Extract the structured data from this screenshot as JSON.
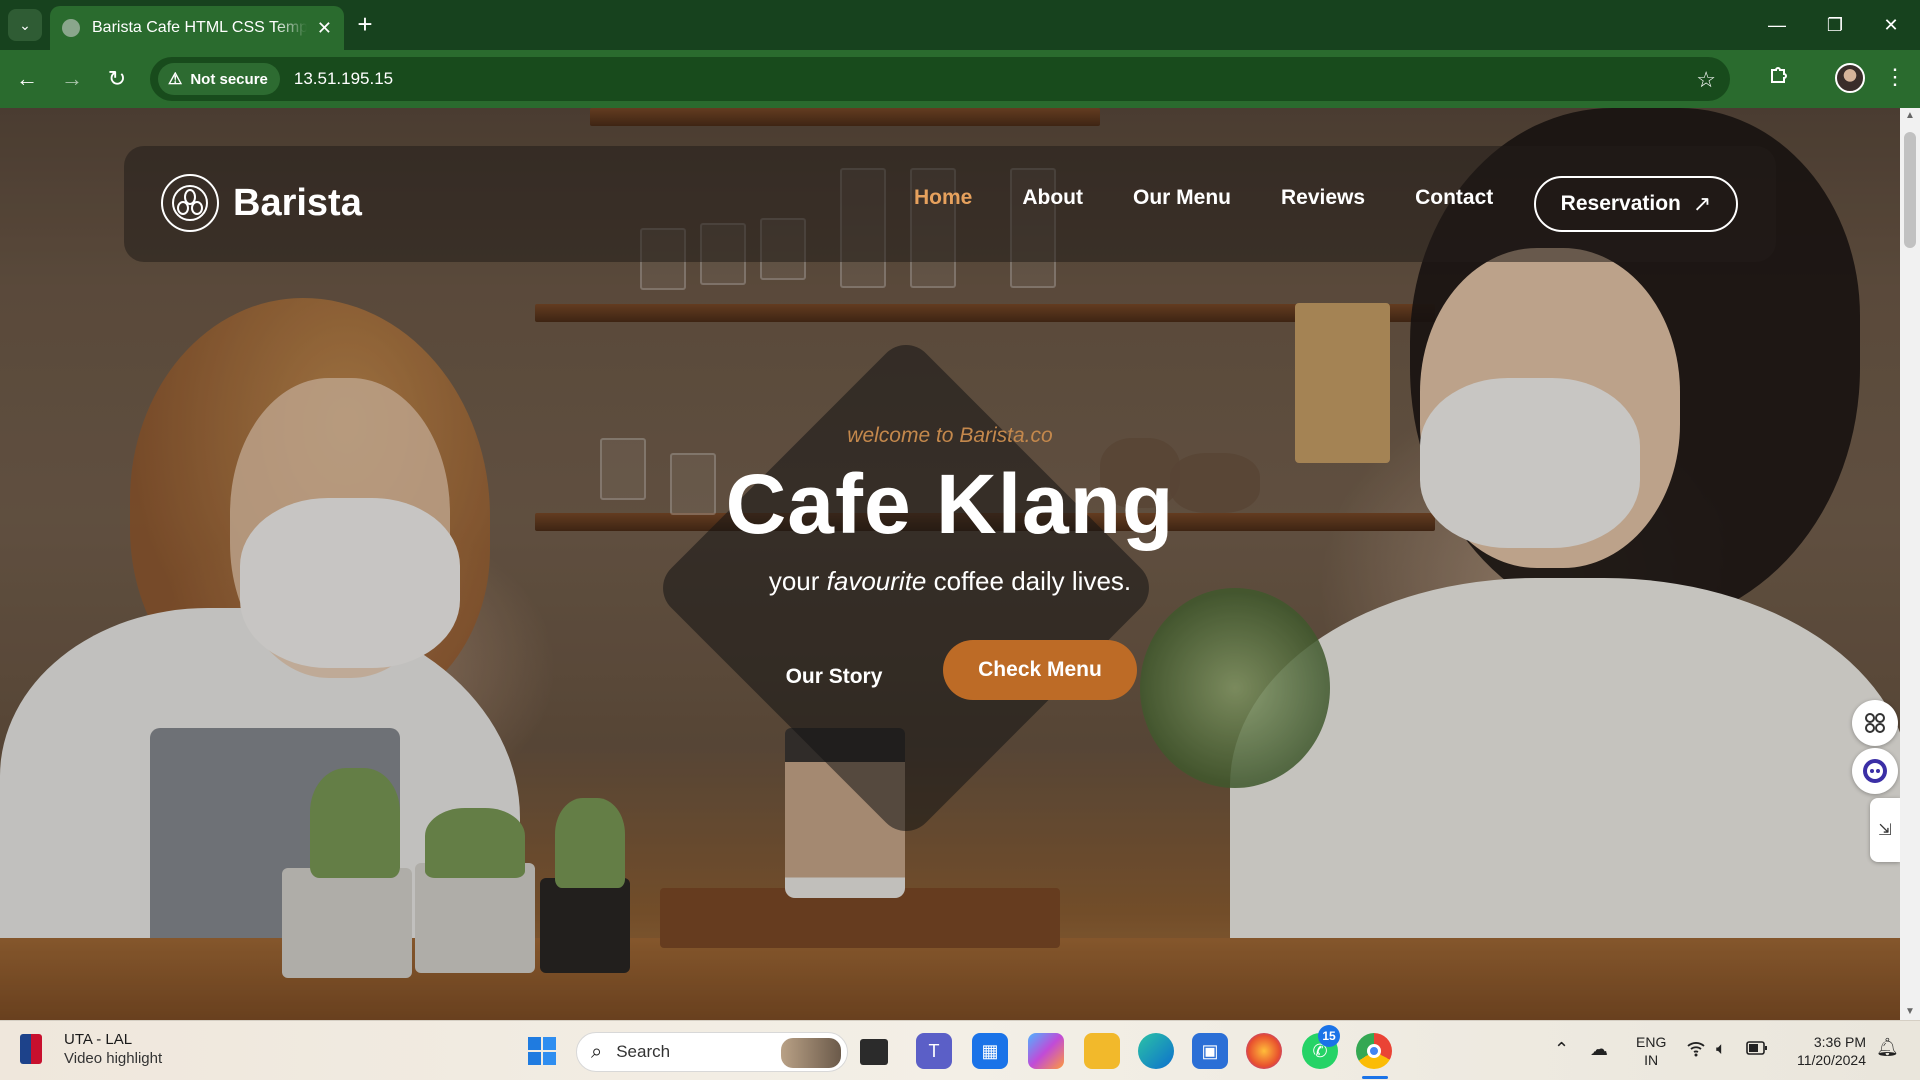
{
  "browser": {
    "tab_title": "Barista Cafe HTML CSS Template",
    "tab_close": "✕",
    "new_tab": "+",
    "security_label": "Not secure",
    "url": "13.51.195.15",
    "window_controls": {
      "minimize": "—",
      "restore": "❐",
      "close": "✕"
    }
  },
  "site": {
    "brand": "Barista",
    "nav": [
      "Home",
      "About",
      "Our Menu",
      "Reviews",
      "Contact"
    ],
    "active_nav": "Home",
    "reservation_label": "Reservation",
    "reservation_arrow": "↗",
    "accent_color": "#e6a15d",
    "button_color": "#bd6b26"
  },
  "hero": {
    "welcome": "welcome to Barista.co",
    "title": "Cafe Klang",
    "subtitle_pre": "your ",
    "subtitle_em": "favourite",
    "subtitle_post": " coffee daily lives.",
    "story_button": "Our Story",
    "menu_button": "Check Menu"
  },
  "taskbar": {
    "news_title": "UTA - LAL",
    "news_subtitle": "Video highlight",
    "search_placeholder": "Search",
    "whatsapp_badge": "15",
    "language": "ENG",
    "region": "IN",
    "time": "3:36 PM",
    "date": "11/20/2024",
    "app_icons": [
      "windows-start",
      "search",
      "task-view",
      "teams",
      "calendar",
      "copilot",
      "file-explorer",
      "edge",
      "microsoft-store",
      "firefox",
      "whatsapp",
      "chrome"
    ]
  }
}
